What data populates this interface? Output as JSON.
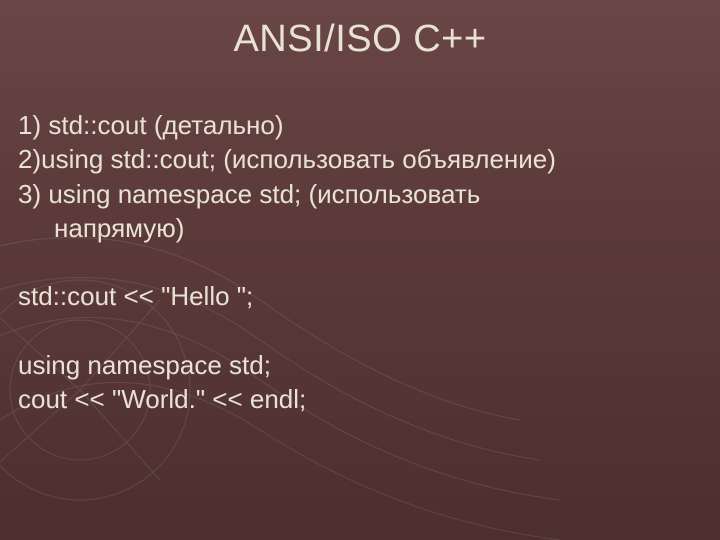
{
  "title": "ANSI/ISO C++",
  "lines": {
    "l1": "1) std::cout (детально)",
    "l2": "2)using std::cout; (использовать объявление)",
    "l3a": "3) using namespace std; (использовать",
    "l3b": "напрямую)",
    "l4": "std::cout << \"Hello \";",
    "l5": "using namespace std;",
    "l6": "cout << \"World.\" << endl;"
  }
}
